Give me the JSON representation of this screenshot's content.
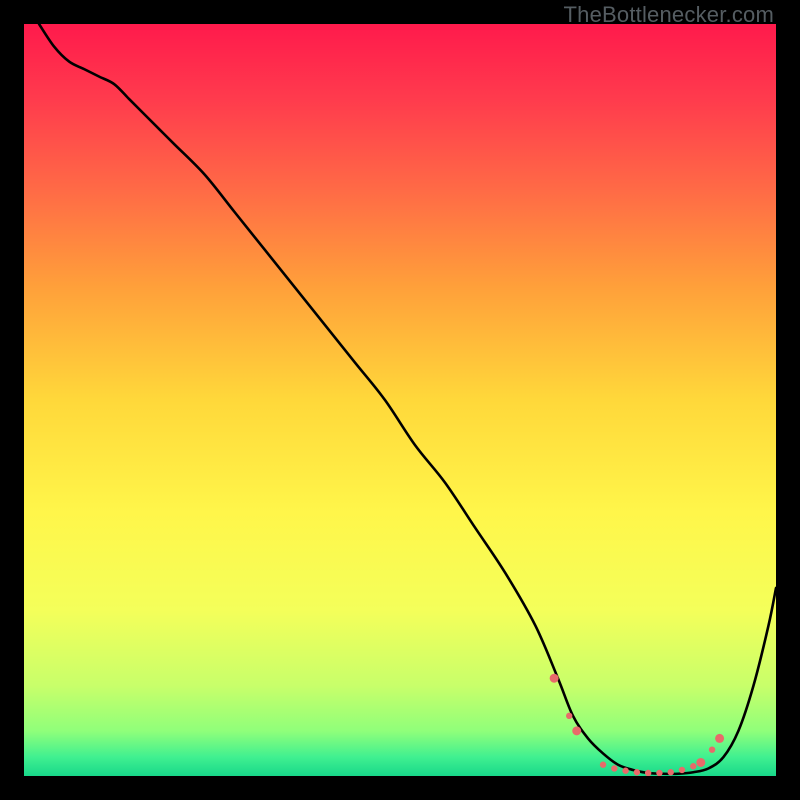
{
  "watermark": "TheBottlenecker.com",
  "chart_data": {
    "type": "line",
    "title": "",
    "xlabel": "",
    "ylabel": "",
    "xlim": [
      0,
      100
    ],
    "ylim": [
      0,
      100
    ],
    "background_gradient": {
      "stops": [
        {
          "offset": 0.0,
          "color": "#ff1a4c"
        },
        {
          "offset": 0.1,
          "color": "#ff3b4d"
        },
        {
          "offset": 0.22,
          "color": "#ff6a46"
        },
        {
          "offset": 0.35,
          "color": "#ffa03a"
        },
        {
          "offset": 0.5,
          "color": "#ffd83a"
        },
        {
          "offset": 0.65,
          "color": "#fff64a"
        },
        {
          "offset": 0.78,
          "color": "#f4ff5a"
        },
        {
          "offset": 0.88,
          "color": "#c8ff6a"
        },
        {
          "offset": 0.94,
          "color": "#90ff7a"
        },
        {
          "offset": 0.975,
          "color": "#40f090"
        },
        {
          "offset": 1.0,
          "color": "#18d88a"
        }
      ]
    },
    "series": [
      {
        "name": "bottleneck-curve",
        "x": [
          2,
          4,
          6,
          8,
          10,
          12,
          14,
          16,
          18,
          20,
          24,
          28,
          32,
          36,
          40,
          44,
          48,
          52,
          56,
          60,
          64,
          68,
          71,
          73,
          75,
          77,
          79,
          81,
          83,
          85,
          87,
          89,
          91,
          93,
          95,
          97,
          99,
          100
        ],
        "y": [
          100,
          97,
          95,
          94,
          93,
          92,
          90,
          88,
          86,
          84,
          80,
          75,
          70,
          65,
          60,
          55,
          50,
          44,
          39,
          33,
          27,
          20,
          13,
          8,
          5,
          3,
          1.5,
          0.8,
          0.4,
          0.3,
          0.3,
          0.5,
          1.0,
          2.5,
          6,
          12,
          20,
          25
        ]
      }
    ],
    "markers": {
      "name": "highlight-dots",
      "color": "#e86a6a",
      "radius_small": 3.2,
      "radius_large": 4.5,
      "points": [
        {
          "x": 70.5,
          "y": 13,
          "r": "large"
        },
        {
          "x": 72.5,
          "y": 8,
          "r": "small"
        },
        {
          "x": 73.5,
          "y": 6,
          "r": "large"
        },
        {
          "x": 77.0,
          "y": 1.5,
          "r": "small"
        },
        {
          "x": 78.5,
          "y": 1.0,
          "r": "small"
        },
        {
          "x": 80.0,
          "y": 0.7,
          "r": "small"
        },
        {
          "x": 81.5,
          "y": 0.5,
          "r": "small"
        },
        {
          "x": 83.0,
          "y": 0.4,
          "r": "small"
        },
        {
          "x": 84.5,
          "y": 0.4,
          "r": "small"
        },
        {
          "x": 86.0,
          "y": 0.5,
          "r": "small"
        },
        {
          "x": 87.5,
          "y": 0.8,
          "r": "small"
        },
        {
          "x": 89.0,
          "y": 1.3,
          "r": "small"
        },
        {
          "x": 90.0,
          "y": 1.8,
          "r": "large"
        },
        {
          "x": 91.5,
          "y": 3.5,
          "r": "small"
        },
        {
          "x": 92.5,
          "y": 5.0,
          "r": "large"
        }
      ]
    }
  }
}
